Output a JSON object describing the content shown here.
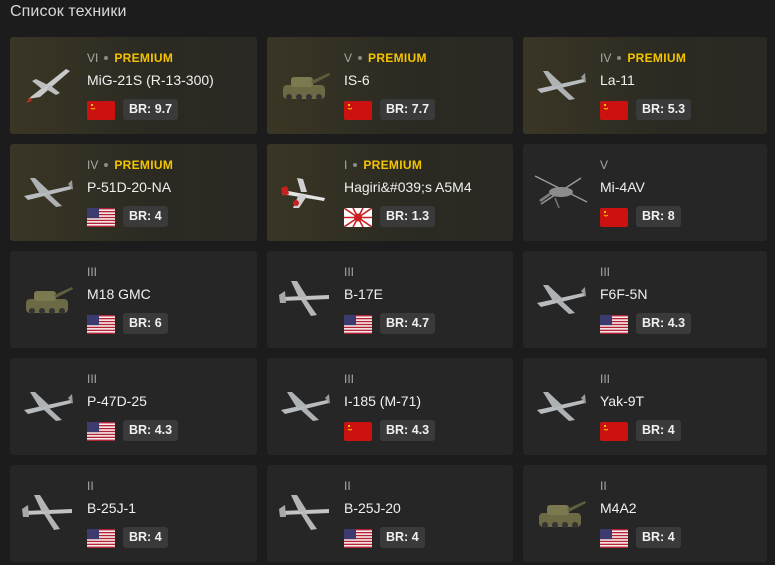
{
  "header": {
    "title": "Список техники"
  },
  "vehicles": [
    {
      "rank": "VI",
      "premium": "PREMIUM",
      "name": "MiG-21S (R-13-300)",
      "br": "BR: 9.7",
      "flag": "ussr",
      "type": "jet"
    },
    {
      "rank": "V",
      "premium": "PREMIUM",
      "name": "IS-6",
      "br": "BR: 7.7",
      "flag": "ussr",
      "type": "tank"
    },
    {
      "rank": "IV",
      "premium": "PREMIUM",
      "name": "La-11",
      "br": "BR: 5.3",
      "flag": "ussr",
      "type": "plane"
    },
    {
      "rank": "IV",
      "premium": "PREMIUM",
      "name": "P-51D-20-NA",
      "br": "BR: 4",
      "flag": "usa",
      "type": "plane"
    },
    {
      "rank": "I",
      "premium": "PREMIUM",
      "name": "Hagiri&#039;s A5M4",
      "br": "BR: 1.3",
      "flag": "japan",
      "type": "plane-red"
    },
    {
      "rank": "V",
      "premium": "",
      "name": "Mi-4AV",
      "br": "BR: 8",
      "flag": "ussr",
      "type": "heli"
    },
    {
      "rank": "III",
      "premium": "",
      "name": "M18 GMC",
      "br": "BR: 6",
      "flag": "usa",
      "type": "tank"
    },
    {
      "rank": "III",
      "premium": "",
      "name": "B-17E",
      "br": "BR: 4.7",
      "flag": "usa",
      "type": "bomber"
    },
    {
      "rank": "III",
      "premium": "",
      "name": "F6F-5N",
      "br": "BR: 4.3",
      "flag": "usa",
      "type": "plane"
    },
    {
      "rank": "III",
      "premium": "",
      "name": "P-47D-25",
      "br": "BR: 4.3",
      "flag": "usa",
      "type": "plane"
    },
    {
      "rank": "III",
      "premium": "",
      "name": "I-185 (M-71)",
      "br": "BR: 4.3",
      "flag": "ussr",
      "type": "plane"
    },
    {
      "rank": "III",
      "premium": "",
      "name": "Yak-9T",
      "br": "BR: 4",
      "flag": "ussr",
      "type": "plane"
    },
    {
      "rank": "II",
      "premium": "",
      "name": "B-25J-1",
      "br": "BR: 4",
      "flag": "usa",
      "type": "bomber"
    },
    {
      "rank": "II",
      "premium": "",
      "name": "B-25J-20",
      "br": "BR: 4",
      "flag": "usa",
      "type": "bomber"
    },
    {
      "rank": "II",
      "premium": "",
      "name": "M4A2",
      "br": "BR: 4",
      "flag": "usa",
      "type": "tank"
    }
  ],
  "colors": {
    "premium_text": "#f5c400",
    "card_bg": "#262626",
    "premium_bg": "#3a3625",
    "page_bg": "#1c1c1c"
  }
}
